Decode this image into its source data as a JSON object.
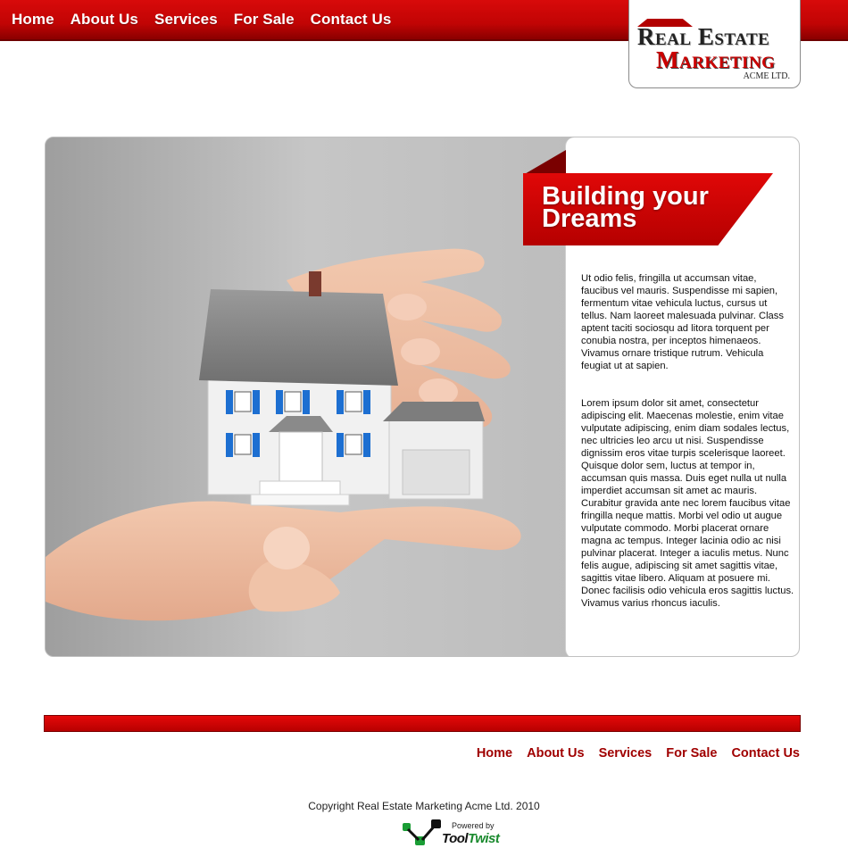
{
  "top_nav": {
    "items": [
      {
        "label": "Home"
      },
      {
        "label": "About Us"
      },
      {
        "label": "Services"
      },
      {
        "label": "For Sale"
      },
      {
        "label": "Contact Us"
      }
    ]
  },
  "logo": {
    "line1": "Real Estate",
    "line2": "Marketing",
    "sub": "ACME LTD."
  },
  "hero": {
    "title": "Building your Dreams",
    "paragraphs": [
      "Ut odio felis, fringilla ut accumsan vitae, faucibus vel mauris. Suspendisse mi sapien, fermentum vitae vehicula luctus, cursus ut tellus. Nam laoreet malesuada pulvinar. Class aptent taciti sociosqu ad litora torquent per conubia nostra, per inceptos himenaeos. Vivamus ornare tristique rutrum. Vehicula feugiat ut at sapien.",
      "Lorem ipsum dolor sit amet, consectetur adipiscing elit. Maecenas molestie, enim vitae vulputate adipiscing, enim diam sodales lectus, nec ultricies leo arcu ut nisi. Suspendisse dignissim eros vitae turpis scelerisque laoreet. Quisque dolor sem, luctus at tempor in, accumsan quis massa. Duis eget nulla ut nulla imperdiet accumsan sit amet ac mauris. Curabitur gravida ante nec lorem faucibus vitae fringilla neque mattis. Morbi vel odio ut augue vulputate commodo. Morbi placerat ornare magna ac tempus. Integer lacinia odio ac nisi pulvinar placerat. Integer a iaculis metus. Nunc felis augue, adipiscing sit amet sagittis vitae, sagittis vitae libero. Aliquam at posuere mi. Donec facilisis odio vehicula eros sagittis luctus. Vivamus varius rhoncus iaculis."
    ]
  },
  "footer_nav": {
    "items": [
      {
        "label": "Home"
      },
      {
        "label": "About Us"
      },
      {
        "label": "Services"
      },
      {
        "label": "For Sale"
      },
      {
        "label": "Contact Us"
      }
    ]
  },
  "footer": {
    "copyright": "Copyright Real Estate Marketing Acme Ltd. 2010",
    "powered_by": "Powered by",
    "brand_part1": "Tool",
    "brand_part2": "Twist"
  },
  "colors": {
    "brand_red": "#cc0000",
    "dark_red": "#a00000"
  }
}
